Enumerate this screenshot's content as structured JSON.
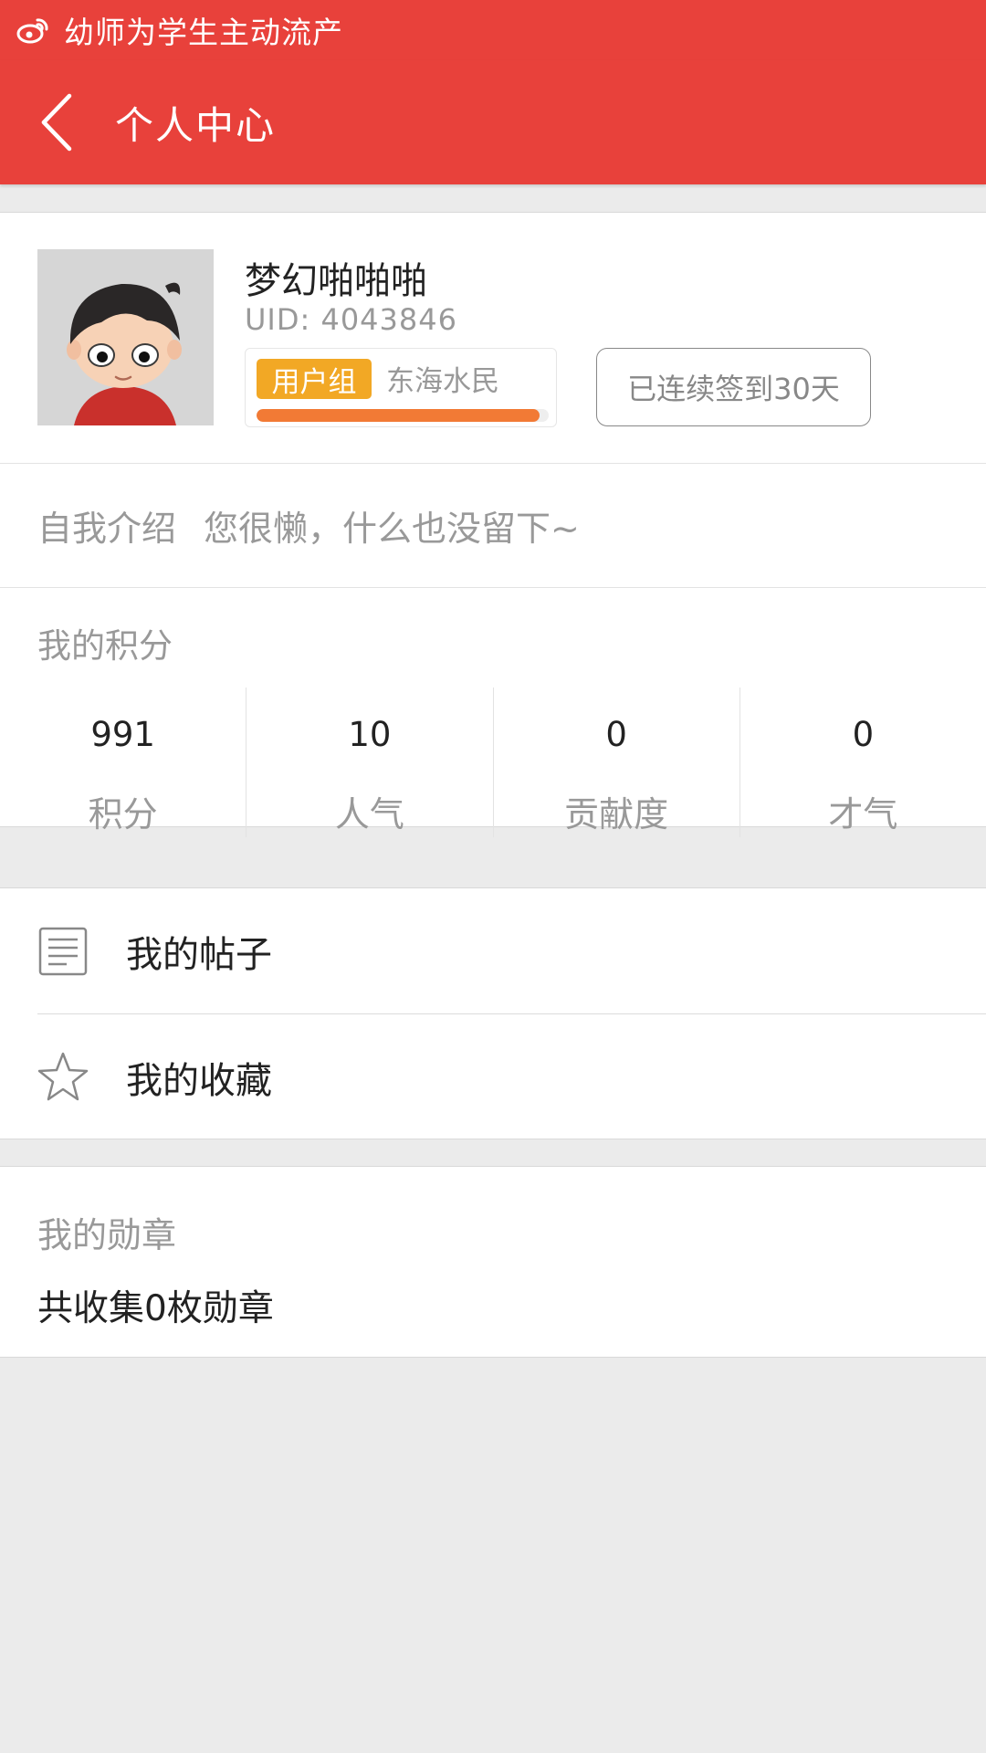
{
  "status_bar": {
    "notification_text": "幼师为学生主动流产",
    "icon": "weibo-icon"
  },
  "header": {
    "title": "个人中心",
    "back_icon": "back-chevron-icon"
  },
  "profile": {
    "username": "梦幻啪啪啪",
    "uid": "UID: 4043846",
    "group_badge": "用户组",
    "group_name": "东海水民",
    "group_progress": 0.97,
    "signin_label": "已连续签到30天",
    "intro_label": "自我介绍",
    "intro_text": "您很懒，什么也没留下~"
  },
  "points": {
    "title": "我的积分",
    "stats": [
      {
        "value": "991",
        "label": "积分"
      },
      {
        "value": "10",
        "label": "人气"
      },
      {
        "value": "0",
        "label": "贡献度"
      },
      {
        "value": "0",
        "label": "才气"
      }
    ]
  },
  "menu": {
    "items": [
      {
        "label": "我的帖子",
        "icon": "document-icon"
      },
      {
        "label": "我的收藏",
        "icon": "star-icon"
      }
    ]
  },
  "medals": {
    "title": "我的勋章",
    "summary": "共收集0枚勋章"
  },
  "colors": {
    "header_red": "#e8413b",
    "badge_orange": "#f2a825",
    "progress_orange": "#f27a35"
  }
}
